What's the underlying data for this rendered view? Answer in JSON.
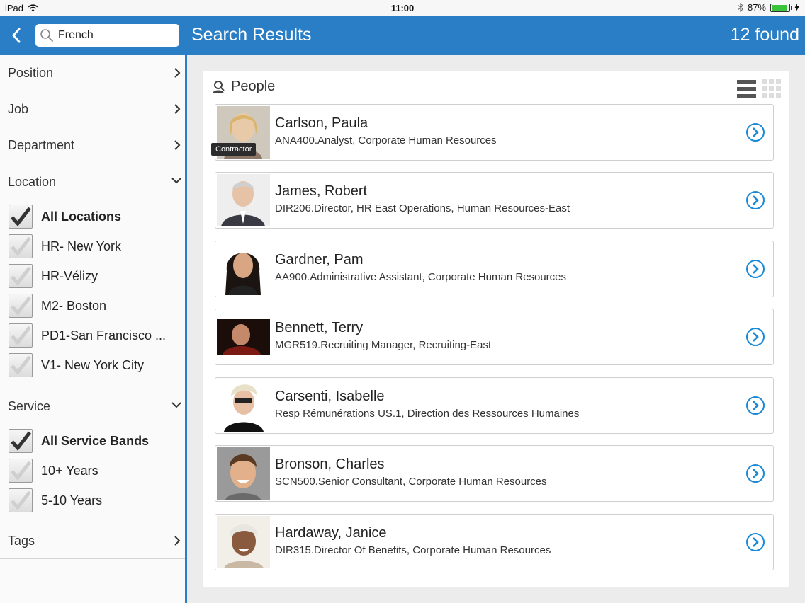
{
  "status_bar": {
    "device": "iPad",
    "time": "11:00",
    "battery": "87%",
    "battery_fraction": 0.87
  },
  "header": {
    "search_value": "French",
    "title": "Search Results",
    "count": "12 found"
  },
  "sidebar": {
    "filters": [
      {
        "label": "Position"
      },
      {
        "label": "Job"
      },
      {
        "label": "Department"
      }
    ],
    "location": {
      "title": "Location",
      "options": [
        {
          "label": "All Locations",
          "checked": true
        },
        {
          "label": "HR- New York",
          "checked": false
        },
        {
          "label": "HR-Vélizy",
          "checked": false
        },
        {
          "label": "M2- Boston",
          "checked": false
        },
        {
          "label": "PD1-San Francisco ...",
          "checked": false
        },
        {
          "label": "V1- New York City",
          "checked": false
        }
      ]
    },
    "service": {
      "title": "Service",
      "options": [
        {
          "label": "All Service Bands",
          "checked": true
        },
        {
          "label": "10+ Years",
          "checked": false
        },
        {
          "label": "5-10 Years",
          "checked": false
        }
      ]
    },
    "tags": {
      "label": "Tags"
    }
  },
  "main": {
    "section_title": "People",
    "people": [
      {
        "name": "Carlson, Paula",
        "job": "ANA400.Analyst, Corporate Human Resources",
        "badge": "Contractor"
      },
      {
        "name": "James, Robert",
        "job": "DIR206.Director, HR East Operations, Human Resources-East"
      },
      {
        "name": "Gardner, Pam",
        "job": "AA900.Administrative Assistant, Corporate Human Resources"
      },
      {
        "name": "Bennett, Terry",
        "job": "MGR519.Recruiting Manager, Recruiting-East"
      },
      {
        "name": "Carsenti, Isabelle",
        "job": "Resp Rémunérations US.1, Direction des Ressources Humaines"
      },
      {
        "name": "Bronson, Charles",
        "job": "SCN500.Senior Consultant, Corporate Human Resources"
      },
      {
        "name": "Hardaway, Janice",
        "job": "DIR315.Director Of Benefits, Corporate Human Resources"
      }
    ]
  },
  "colors": {
    "accent": "#2a7ec5",
    "link": "#1a8ad8"
  }
}
